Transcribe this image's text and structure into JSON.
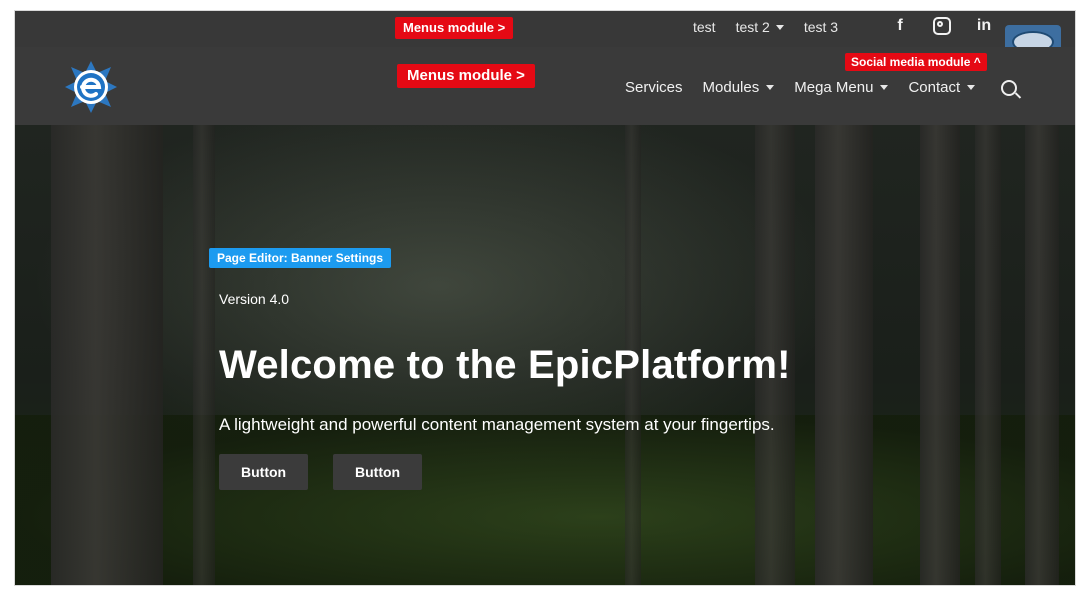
{
  "topbar": {
    "menus_badge": "Menus module >",
    "links": [
      {
        "label": "test",
        "has_caret": false
      },
      {
        "label": "test 2",
        "has_caret": true
      },
      {
        "label": "test 3",
        "has_caret": false
      }
    ],
    "social_icons": [
      "facebook-icon",
      "instagram-icon",
      "linkedin-icon"
    ]
  },
  "header": {
    "menus_badge": "Menus module >",
    "social_badge": "Social media module ^",
    "nav": [
      {
        "label": "Services",
        "has_caret": false
      },
      {
        "label": "Modules",
        "has_caret": true
      },
      {
        "label": "Mega Menu",
        "has_caret": true
      },
      {
        "label": "Contact",
        "has_caret": true
      }
    ]
  },
  "banner": {
    "editor_badge": "Page Editor: Banner Settings",
    "version": "Version 4.0",
    "headline": "Welcome to the EpicPlatform!",
    "subline": "A lightweight and powerful content management system at your fingertips.",
    "buttons": [
      "Button",
      "Button"
    ]
  },
  "colors": {
    "module_badge": "#e50914",
    "editor_badge": "#1c9bf0",
    "header_bg": "#3a3a3a",
    "topbar_bg": "#383838"
  }
}
